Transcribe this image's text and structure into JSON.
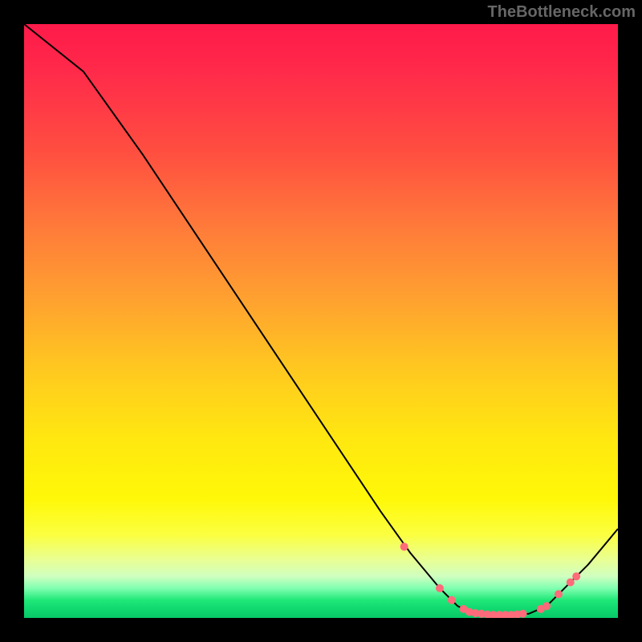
{
  "watermark": "TheBottleneck.com",
  "chart_data": {
    "type": "line",
    "title": "",
    "xlabel": "",
    "ylabel": "",
    "xlim": [
      0,
      100
    ],
    "ylim": [
      0,
      100
    ],
    "series": [
      {
        "name": "curve",
        "x": [
          0,
          10,
          20,
          30,
          40,
          50,
          60,
          65,
          70,
          73,
          75,
          78,
          80,
          82,
          85,
          88,
          90,
          95,
          100
        ],
        "values": [
          100,
          92,
          78,
          63,
          48,
          33,
          18,
          11,
          5,
          2,
          1,
          0.5,
          0.5,
          0.5,
          0.7,
          2,
          4,
          9,
          15
        ]
      }
    ],
    "markers": {
      "name": "highlighted-points",
      "color": "#ff6b7a",
      "x": [
        64,
        70,
        72,
        74,
        75,
        76,
        77,
        78,
        79,
        80,
        81,
        82,
        83,
        84,
        87,
        88,
        90,
        92,
        93
      ],
      "values": [
        12,
        5,
        3,
        1.5,
        1,
        0.8,
        0.7,
        0.6,
        0.5,
        0.5,
        0.5,
        0.5,
        0.6,
        0.7,
        1.5,
        2,
        4,
        6,
        7
      ]
    }
  }
}
